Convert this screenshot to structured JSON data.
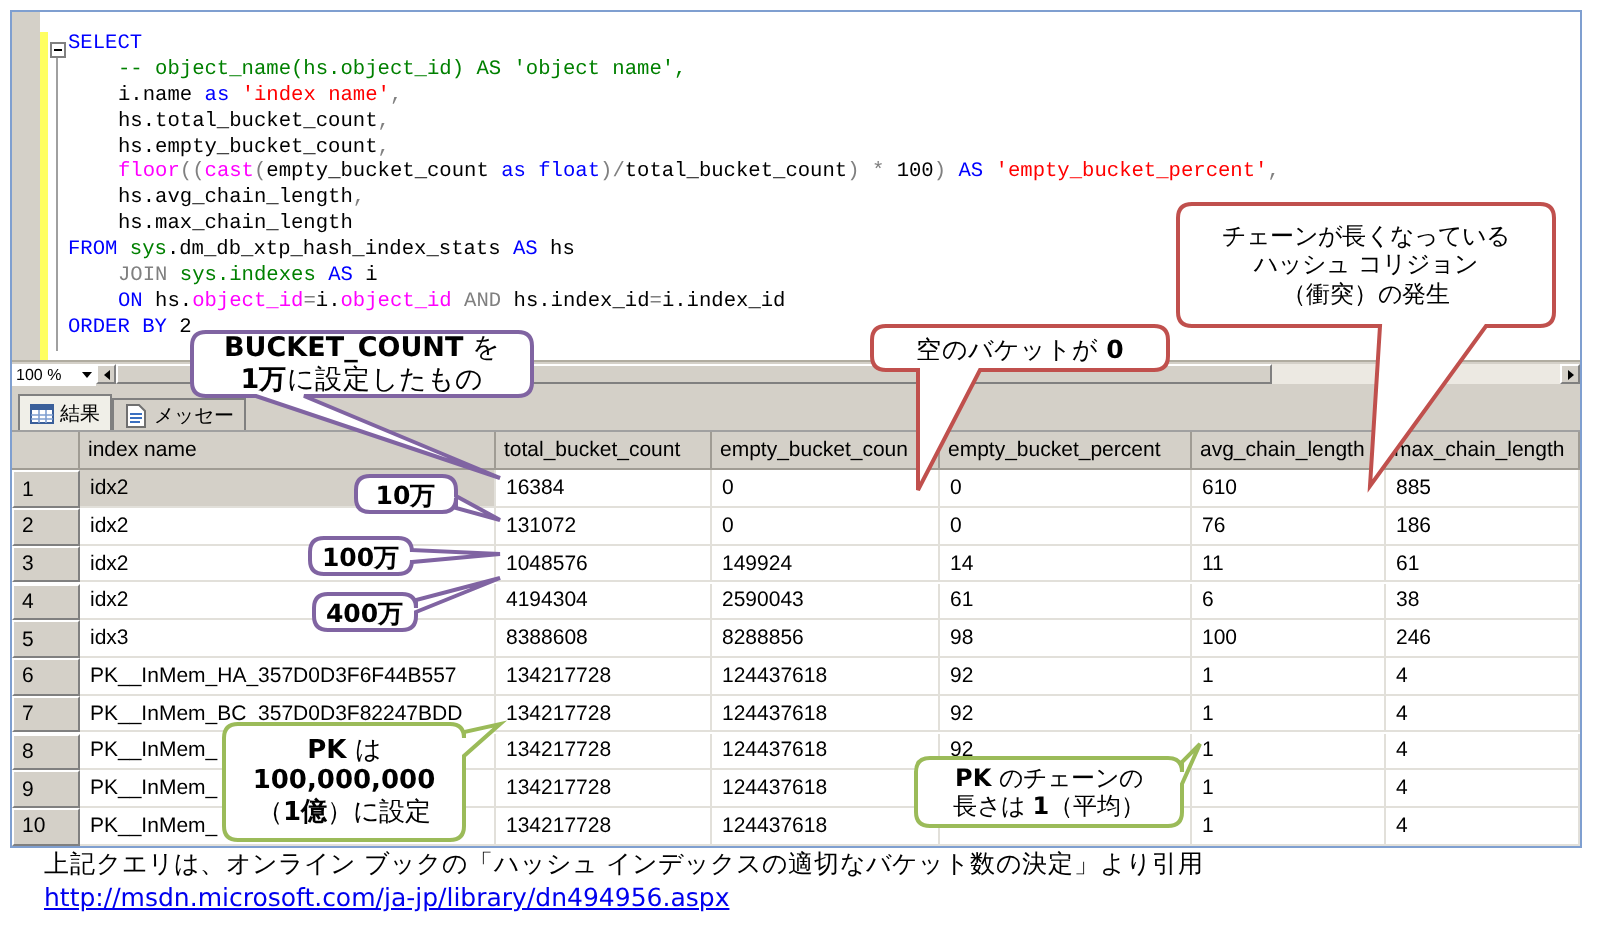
{
  "editor": {
    "lines": [
      {
        "indented": false,
        "tokens": [
          {
            "kind": "keyword",
            "text": "SELECT"
          }
        ]
      },
      {
        "indented": true,
        "tokens": [
          {
            "kind": "comment",
            "text": "-- object_name(hs.object_id) AS 'object name',"
          }
        ]
      },
      {
        "indented": true,
        "tokens": [
          {
            "kind": "plain",
            "text": "i.name "
          },
          {
            "kind": "keyword",
            "text": "as "
          },
          {
            "kind": "string",
            "text": "'index name'"
          },
          {
            "kind": "operator",
            "text": ","
          }
        ]
      },
      {
        "indented": true,
        "tokens": [
          {
            "kind": "plain",
            "text": "hs.total_bucket_count"
          },
          {
            "kind": "operator",
            "text": ","
          }
        ]
      },
      {
        "indented": true,
        "tokens": [
          {
            "kind": "plain",
            "text": "hs.empty_bucket_count"
          },
          {
            "kind": "operator",
            "text": ","
          }
        ]
      },
      {
        "indented": true,
        "tokens": [
          {
            "kind": "function",
            "text": "floor"
          },
          {
            "kind": "operator",
            "text": "(("
          },
          {
            "kind": "function",
            "text": "cast"
          },
          {
            "kind": "operator",
            "text": "("
          },
          {
            "kind": "plain",
            "text": "empty_bucket_count "
          },
          {
            "kind": "keyword",
            "text": "as float"
          },
          {
            "kind": "operator",
            "text": ")/"
          },
          {
            "kind": "plain",
            "text": "total_bucket_count"
          },
          {
            "kind": "operator",
            "text": ") * "
          },
          {
            "kind": "plain",
            "text": "100"
          },
          {
            "kind": "operator",
            "text": ") "
          },
          {
            "kind": "keyword",
            "text": "AS "
          },
          {
            "kind": "string",
            "text": "'empty_bucket_percent'"
          },
          {
            "kind": "operator",
            "text": ","
          }
        ]
      },
      {
        "indented": true,
        "tokens": [
          {
            "kind": "plain",
            "text": "hs.avg_chain_length"
          },
          {
            "kind": "operator",
            "text": ","
          }
        ]
      },
      {
        "indented": true,
        "tokens": [
          {
            "kind": "plain",
            "text": "hs.max_chain_length"
          }
        ]
      },
      {
        "indented": false,
        "tokens": [
          {
            "kind": "keyword",
            "text": "FROM "
          },
          {
            "kind": "system",
            "text": "sys"
          },
          {
            "kind": "plain",
            "text": ".dm_db_xtp_hash_index_stats "
          },
          {
            "kind": "keyword",
            "text": "AS"
          },
          {
            "kind": "plain",
            "text": " hs"
          }
        ]
      },
      {
        "indented": true,
        "tokens": [
          {
            "kind": "operator",
            "text": "JOIN "
          },
          {
            "kind": "system",
            "text": "sys.indexes "
          },
          {
            "kind": "keyword",
            "text": "AS"
          },
          {
            "kind": "plain",
            "text": " i"
          }
        ]
      },
      {
        "indented": true,
        "tokens": [
          {
            "kind": "keyword",
            "text": "ON"
          },
          {
            "kind": "plain",
            "text": " hs."
          },
          {
            "kind": "function",
            "text": "object_id"
          },
          {
            "kind": "operator",
            "text": "="
          },
          {
            "kind": "plain",
            "text": "i."
          },
          {
            "kind": "function",
            "text": "object_id "
          },
          {
            "kind": "operator",
            "text": "AND"
          },
          {
            "kind": "plain",
            "text": " hs.index_id"
          },
          {
            "kind": "operator",
            "text": "="
          },
          {
            "kind": "plain",
            "text": "i.index_id"
          }
        ]
      },
      {
        "indented": false,
        "tokens": [
          {
            "kind": "keyword",
            "text": "ORDER BY"
          },
          {
            "kind": "plain",
            "text": " 2"
          }
        ]
      }
    ]
  },
  "zoom": {
    "value": "100 %"
  },
  "result_tabs": [
    {
      "label": "結果",
      "kind": "grid",
      "selected": true
    },
    {
      "label": "メッセー",
      "kind": "message",
      "selected": false
    }
  ],
  "grid": {
    "columns": [
      "index name",
      "total_bucket_count",
      "empty_bucket_coun",
      "empty_bucket_percent",
      "avg_chain_length",
      "max_chain_length"
    ],
    "rows": [
      {
        "number": "1",
        "selected": true,
        "cells": [
          "idx2",
          "16384",
          "0",
          "0",
          "610",
          "885"
        ]
      },
      {
        "number": "2",
        "selected": false,
        "cells": [
          "idx2",
          "131072",
          "0",
          "0",
          "76",
          "186"
        ]
      },
      {
        "number": "3",
        "selected": false,
        "cells": [
          "idx2",
          "1048576",
          "149924",
          "14",
          "11",
          "61"
        ]
      },
      {
        "number": "4",
        "selected": false,
        "cells": [
          "idx2",
          "4194304",
          "2590043",
          "61",
          "6",
          "38"
        ]
      },
      {
        "number": "5",
        "selected": false,
        "cells": [
          "idx3",
          "8388608",
          "8288856",
          "98",
          "100",
          "246"
        ]
      },
      {
        "number": "6",
        "selected": false,
        "cells": [
          "PK__InMem_HA_357D0D3F6F44B557",
          "134217728",
          "124437618",
          "92",
          "1",
          "4"
        ]
      },
      {
        "number": "7",
        "selected": false,
        "cells": [
          "PK__InMem_BC_357D0D3F82247BDD",
          "134217728",
          "124437618",
          "92",
          "1",
          "4"
        ]
      },
      {
        "number": "8",
        "selected": false,
        "cells": [
          "PK__InMem_",
          "134217728",
          "124437618",
          "92",
          "1",
          "4"
        ]
      },
      {
        "number": "9",
        "selected": false,
        "cells": [
          "PK__InMem_",
          "134217728",
          "124437618",
          null,
          "1",
          "4"
        ]
      },
      {
        "number": "10",
        "selected": false,
        "cells": [
          "PK__InMem_",
          "134217728",
          "124437618",
          null,
          "1",
          "4"
        ]
      }
    ]
  },
  "callouts": [
    {
      "color": "#8064a2",
      "lines": [
        "**BUCKET_COUNT** を",
        "**1万**に設定したもの"
      ]
    },
    {
      "color": "#8064a2",
      "lines": [
        "**10万**"
      ]
    },
    {
      "color": "#8064a2",
      "lines": [
        "**100万**"
      ]
    },
    {
      "color": "#8064a2",
      "lines": [
        "**400万**"
      ]
    },
    {
      "color": "#c0504d",
      "lines": [
        "空のバケットが **0**"
      ]
    },
    {
      "color": "#c0504d",
      "lines": [
        "チェーンが長くなっている",
        "ハッシュ コリジョン",
        "（衝突）の発生"
      ]
    },
    {
      "color": "#9bbb59",
      "lines": [
        "**PK** は",
        "**100,000,000**",
        "（**1億**）に設定"
      ]
    },
    {
      "color": "#9bbb59",
      "lines": [
        "**PK** のチェーンの",
        "長さは **1**（平均）"
      ]
    }
  ],
  "caption": {
    "text": "上記クエリは、オンライン ブックの「ハッシュ インデックスの適切なバケット数の決定」より引用",
    "link": "http://msdn.microsoft.com/ja-jp/library/dn494956.aspx"
  }
}
